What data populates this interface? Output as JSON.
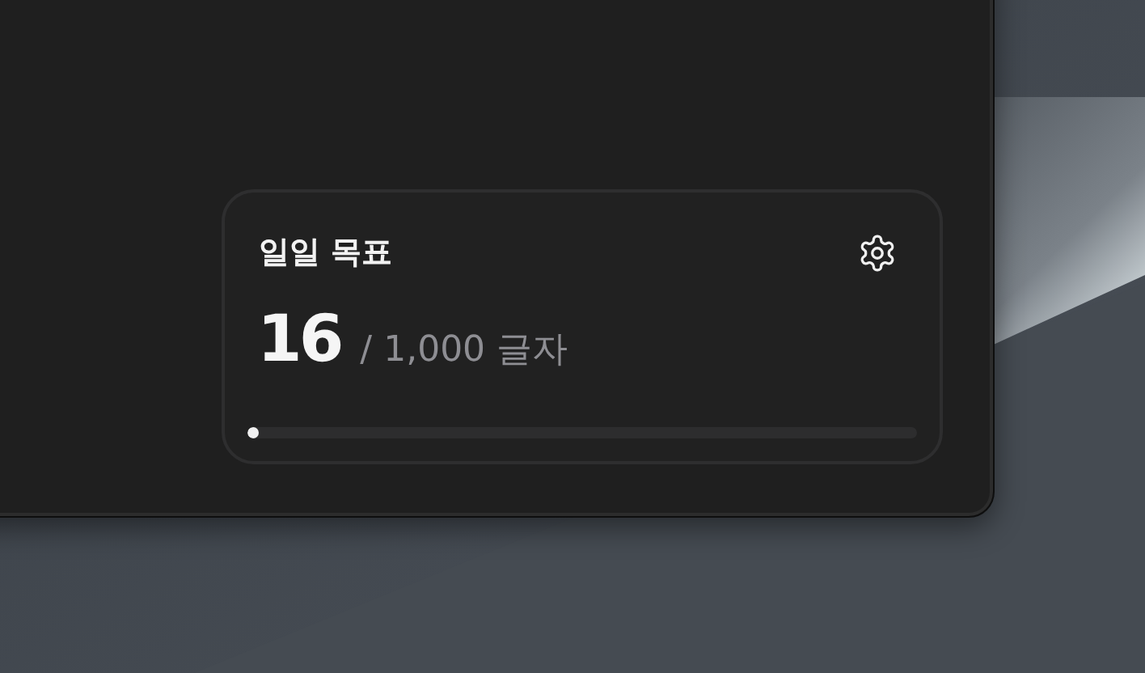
{
  "goal_card": {
    "title": "일일 목표",
    "count": "16",
    "target": "/ 1,000 글자",
    "progress": {
      "level": 0.016
    }
  }
}
